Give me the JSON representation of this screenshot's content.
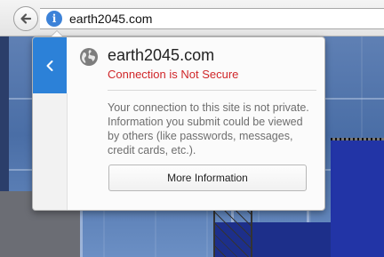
{
  "toolbar": {
    "url": "earth2045.com",
    "back_icon": "back-arrow-icon",
    "info_icon": "i"
  },
  "popup": {
    "site": "earth2045.com",
    "status": "Connection is Not Secure",
    "description": "Your connection to this site is not private. Information you submit could be viewed by others (like passwords, messages, credit cards, etc.).",
    "more_button_label": "More Information",
    "side_back_icon": "chevron-left-icon",
    "site_icon": "globe-icon"
  },
  "colors": {
    "accent": "#2c81d8",
    "insecure": "#d0272a"
  }
}
